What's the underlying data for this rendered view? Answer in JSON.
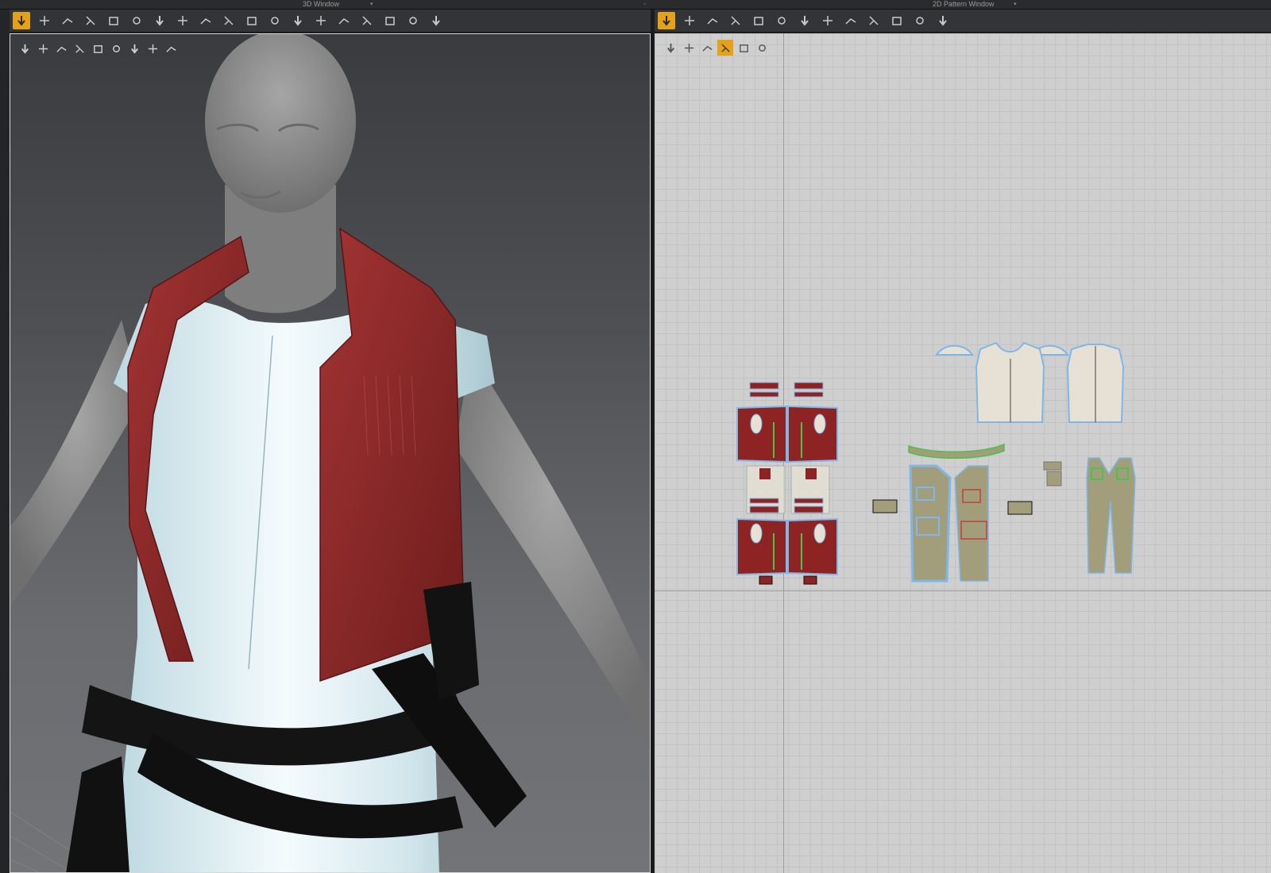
{
  "window3d": {
    "title": "3D Window",
    "toolbar": [
      {
        "icon": "select-move-icon",
        "active": true
      },
      {
        "icon": "transform-pattern-icon"
      },
      {
        "icon": "edit-curvature-icon"
      },
      {
        "icon": "fold-arrangement-icon"
      },
      {
        "icon": "sewing-icon"
      },
      {
        "icon": "fold-garment-icon"
      },
      {
        "icon": "strengthen-icon"
      },
      {
        "icon": "pin-icon"
      },
      {
        "icon": "tack-icon"
      },
      {
        "icon": "shirring-icon"
      },
      {
        "icon": "measure-icon"
      },
      {
        "icon": "seamline-icon"
      },
      {
        "icon": "button-icon"
      },
      {
        "icon": "buttonhole-icon"
      },
      {
        "icon": "zipper-icon"
      },
      {
        "icon": "elastic-icon"
      },
      {
        "icon": "topstitch-icon"
      },
      {
        "icon": "puckering-icon"
      },
      {
        "icon": "avatar-measure-icon"
      }
    ],
    "view_tools": [
      {
        "icon": "texture-view-icon"
      },
      {
        "icon": "garment-view-icon"
      },
      {
        "icon": "stress-map-icon"
      },
      {
        "icon": "avatar-view-icon"
      },
      {
        "icon": "sew-view-icon"
      },
      {
        "icon": "arrangement-view-icon"
      },
      {
        "icon": "skin-view-icon"
      },
      {
        "icon": "environment-icon"
      },
      {
        "icon": "export-icon"
      }
    ]
  },
  "window2d": {
    "title": "2D Pattern Window",
    "toolbar": [
      {
        "icon": "transform-pattern-icon",
        "active": true
      },
      {
        "icon": "edit-point-icon"
      },
      {
        "icon": "polygon-icon"
      },
      {
        "icon": "rectangle-icon"
      },
      {
        "icon": "internal-line-icon"
      },
      {
        "icon": "trace-icon"
      },
      {
        "icon": "grading-icon"
      },
      {
        "icon": "dart-icon"
      },
      {
        "icon": "segment-sewing-icon"
      },
      {
        "icon": "free-sewing-icon"
      },
      {
        "icon": "pleat-icon"
      },
      {
        "icon": "edit-sewing-icon"
      },
      {
        "icon": "shirt-icon"
      }
    ],
    "view_tools": [
      {
        "icon": "show-lines-icon"
      },
      {
        "icon": "show-sewing-icon"
      },
      {
        "icon": "texture-icon",
        "active": false
      },
      {
        "icon": "pattern-color-icon",
        "active": true
      },
      {
        "icon": "baseline-icon"
      },
      {
        "icon": "export-pattern-icon"
      }
    ]
  },
  "colors": {
    "accent": "#e3a21a",
    "vest_red": "#8e2323",
    "shirt_white": "#e6e1d4",
    "pants_khaki": "#a29d7a",
    "seam_blue": "#7fb7e8",
    "seam_green": "#4bc24b"
  }
}
